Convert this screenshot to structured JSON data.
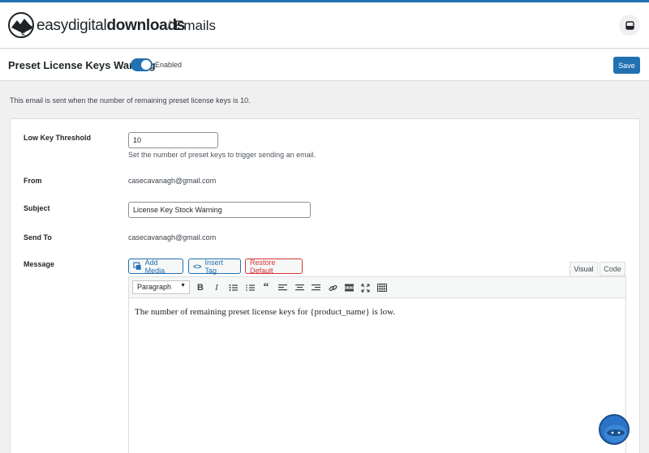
{
  "header": {
    "brand_light": "easy",
    "brand_mid": "digital",
    "brand_bold": "downloads",
    "separator": "/",
    "page": "Emails"
  },
  "subheader": {
    "title": "Preset License Keys Warning",
    "toggle_label": "Enabled",
    "toggle_on": true,
    "save_label": "Save"
  },
  "description": "This email is sent when the number of remaining preset license keys is 10.",
  "form": {
    "threshold_label": "Low Key Threshold",
    "threshold_value": "10",
    "threshold_help": "Set the number of preset keys to trigger sending an email.",
    "from_label": "From",
    "from_value": "casecavanagh@gmail.com",
    "subject_label": "Subject",
    "subject_value": "License Key Stock Warning",
    "sendto_label": "Send To",
    "sendto_value": "casecavanagh@gmail.com",
    "message_label": "Message"
  },
  "editor": {
    "add_media": "Add Media",
    "insert_tag": "Insert Tag",
    "restore_default": "Restore Default",
    "tab_visual": "Visual",
    "tab_code": "Code",
    "format_value": "Paragraph",
    "content": "The number of remaining preset license keys for {product_name} is low."
  },
  "colors": {
    "accent": "#2271b1",
    "danger": "#d63638"
  }
}
